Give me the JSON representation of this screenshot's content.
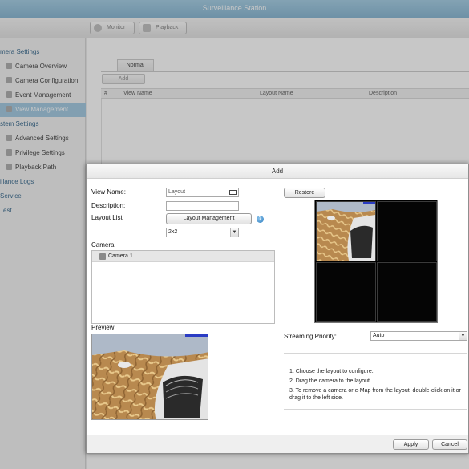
{
  "window": {
    "title": "Surveillance Station"
  },
  "toolbar": {
    "monitor_label": "Monitor",
    "playback_label": "Playback"
  },
  "sidebar": {
    "items": [
      {
        "label": "mera Settings",
        "sub": false
      },
      {
        "label": "Camera Overview",
        "sub": true
      },
      {
        "label": "Camera Configuration",
        "sub": true
      },
      {
        "label": "Event Management",
        "sub": true
      },
      {
        "label": "View Management",
        "sub": true,
        "active": true
      },
      {
        "label": "stem Settings",
        "sub": false
      },
      {
        "label": "Advanced Settings",
        "sub": true
      },
      {
        "label": "Privilege Settings",
        "sub": true
      },
      {
        "label": "Playback Path",
        "sub": true
      },
      {
        "label": "illance Logs",
        "sub": false
      },
      {
        "label": "Service",
        "sub": false
      },
      {
        "label": "Test",
        "sub": false
      }
    ]
  },
  "main": {
    "tab_label": "Normal",
    "add_button": "Add",
    "columns": [
      "#",
      "View Name",
      "Layout Name",
      "Description"
    ]
  },
  "dialog": {
    "title": "Add",
    "view_name_label": "View Name:",
    "view_name_placeholder": "Layout",
    "description_label": "Description:",
    "description_value": "",
    "layout_list_label": "Layout List",
    "layout_management_button": "Layout Management",
    "help_glyph": "?",
    "layout_select_value": "2x2",
    "camera_label": "Camera",
    "camera_items": [
      "Camera 1"
    ],
    "preview_label": "Preview",
    "restore_button": "Restore",
    "streaming_priority_label": "Streaming Priority:",
    "streaming_priority_value": "Auto",
    "instructions": [
      "1. Choose the layout to configure.",
      "2. Drag the camera to the layout.",
      "3. To remove a camera or e-Map from the layout, double-click on it or drag it to the left side."
    ],
    "apply_button": "Apply",
    "cancel_button": "Cancel",
    "select_arrow_glyph": "▼"
  },
  "colors": {
    "title_bar": "#8fc0dc",
    "active_sidebar": "#9cc6e0",
    "sidebar_text": "#2a5f86",
    "layout_background": "#000000"
  },
  "icons": [
    "monitor-icon",
    "playback-icon",
    "keyboard-icon",
    "help-icon",
    "camera-icon",
    "dropdown-arrow-icon"
  ]
}
